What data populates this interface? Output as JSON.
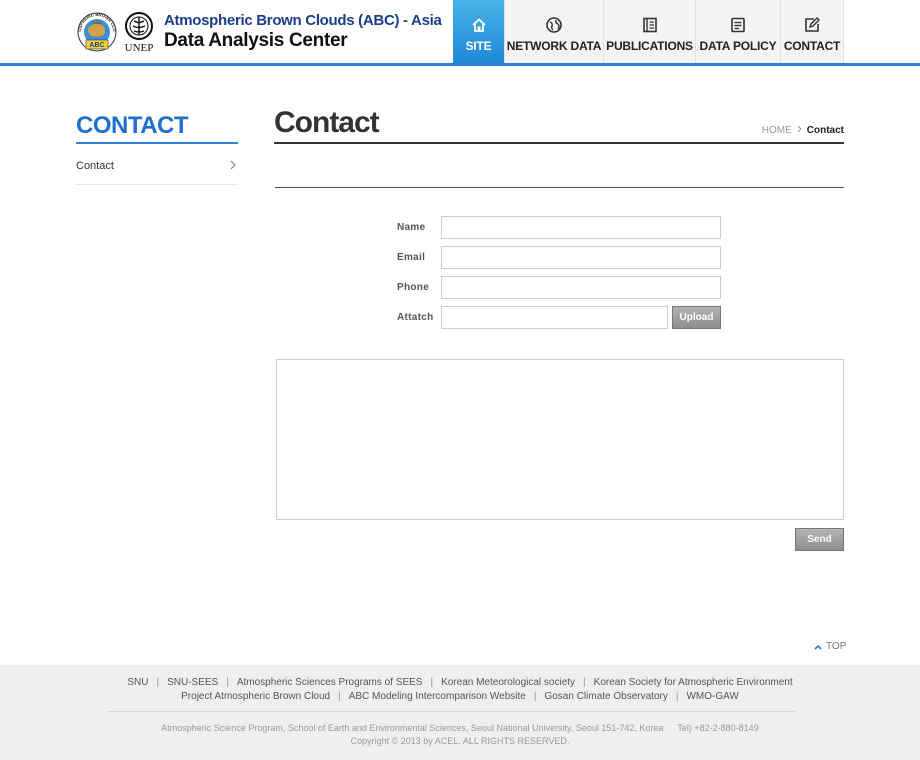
{
  "header": {
    "title_line1": "Atmospheric Brown Clouds (ABC) - Asia",
    "title_line2": "Data Analysis Center",
    "unep_label": "UNEP",
    "abc_badge": "ABC",
    "abc_ring_text": "ATMOSPHERIC BROWN CLOUDS"
  },
  "nav": {
    "items": [
      {
        "label": "SITE",
        "icon": "home-icon",
        "active": true
      },
      {
        "label": "NETWORK DATA",
        "icon": "globe-icon",
        "active": false
      },
      {
        "label": "PUBLICATIONS",
        "icon": "book-icon",
        "active": false
      },
      {
        "label": "DATA POLICY",
        "icon": "document-icon",
        "active": false
      },
      {
        "label": "CONTACT",
        "icon": "edit-icon",
        "active": false
      }
    ]
  },
  "sidebar": {
    "title": "CONTACT",
    "items": [
      {
        "label": "Contact"
      }
    ]
  },
  "main": {
    "title": "Contact",
    "breadcrumb": {
      "home": "HOME",
      "current": "Contact"
    }
  },
  "form": {
    "name_label": "Name",
    "email_label": "Email",
    "phone_label": "Phone",
    "attach_label": "Attatch",
    "name_value": "",
    "email_value": "",
    "phone_value": "",
    "attach_value": "",
    "message_value": "",
    "upload_label": "Upload",
    "send_label": "Send"
  },
  "top_link": "TOP",
  "footer": {
    "links_row1": [
      "SNU",
      "SNU-SEES",
      "Atmospheric Sciences Programs of SEES",
      "Korean Meteorological society",
      "Korean Society for Atmospheric Environment"
    ],
    "links_row2": [
      "Project Atmospheric Brown Cloud",
      "ABC Modeling Intercomparison Website",
      "Gosan Climate Observatory",
      "WMO-GAW"
    ],
    "address": "Atmospheric Science Program, School of Earth and Environmental Sciences, Seoul National University, Seoul 151-742, Korea",
    "tel": "Tel) +82-2-880-8149",
    "copyright": "Copyright © 2013 by ACEL. ALL RIGHTS RESERVED."
  },
  "colors": {
    "accent": "#2b7fd6",
    "nav_active_top": "#47b3e8",
    "nav_active_bottom": "#1f88d6",
    "title_blue": "#1a3e8c"
  }
}
